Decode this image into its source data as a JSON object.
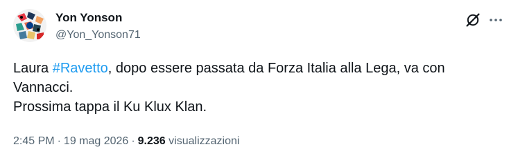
{
  "tweet": {
    "author": {
      "name": "Yon Yonson",
      "handle": "@Yon_Yonson71"
    },
    "text": {
      "line1_before": "Laura ",
      "hashtag": "#Ravetto",
      "line1_after": ", dopo essere passata da Forza Italia alla Lega, va con",
      "line2": "Vannacci.",
      "line3": "Prossima tappa il Ku Klux Klan."
    },
    "meta": {
      "time": "2:45 PM",
      "separator": "·",
      "date": "19 mag 2026",
      "views_count": "9.236",
      "views_label": "visualizzazioni"
    },
    "icons": {
      "grok": "grok-icon",
      "more": "more-icon"
    },
    "colors": {
      "accent": "#1d9bf0",
      "text": "#0f1419",
      "secondary": "#536471"
    }
  }
}
